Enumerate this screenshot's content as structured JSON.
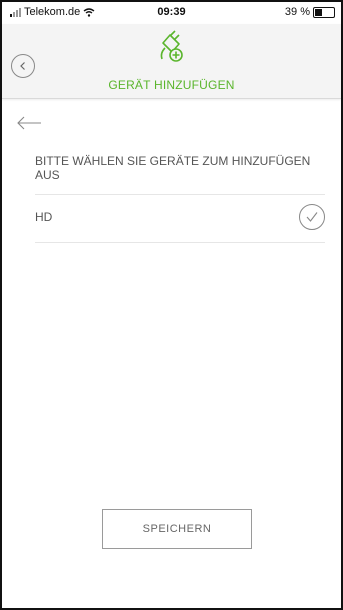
{
  "status_bar": {
    "carrier": "Telekom.de",
    "time": "09:39",
    "battery": "39 %",
    "battery_level": 0.39
  },
  "header": {
    "title": "GERÄT HINZUFÜGEN",
    "icon": "add-plug-icon",
    "accent_color": "#5ab52c"
  },
  "content": {
    "prompt": "BITTE WÄHLEN SIE GERÄTE ZUM HINZUFÜGEN AUS",
    "devices": [
      {
        "label": "HD",
        "icon": "check-circle-icon"
      }
    ]
  },
  "actions": {
    "save_label": "SPEICHERN"
  }
}
